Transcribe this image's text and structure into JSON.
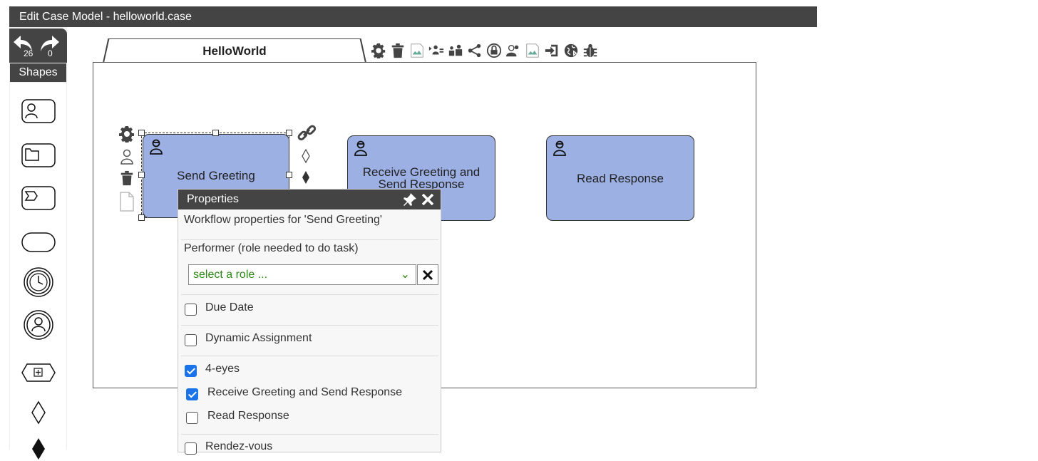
{
  "window": {
    "title": "Edit Case Model - helloworld.case"
  },
  "undo": {
    "undo_count": "26",
    "redo_count": "0"
  },
  "shapes_panel": {
    "label": "Shapes"
  },
  "tab": {
    "title": "HelloWorld"
  },
  "tasks": [
    {
      "label": "Send Greeting"
    },
    {
      "label": "Receive Greeting and Send Response"
    },
    {
      "label": "Read Response"
    }
  ],
  "properties": {
    "header": "Properties",
    "subtitle": "Workflow properties for  'Send Greeting'",
    "performer_label": "Performer (role needed to do task)",
    "role_placeholder": "select a role ...",
    "due_date": "Due Date",
    "dynamic_assignment": "Dynamic Assignment",
    "four_eyes": "4-eyes",
    "opt_receive": "Receive Greeting and Send Response",
    "opt_read": "Read Response",
    "rendezvous": "Rendez-vous"
  },
  "colors": {
    "task_fill": "#9db0e4",
    "header_bg": "#444444",
    "accent_check": "#1a73e8",
    "select_text": "#2a8a12"
  }
}
